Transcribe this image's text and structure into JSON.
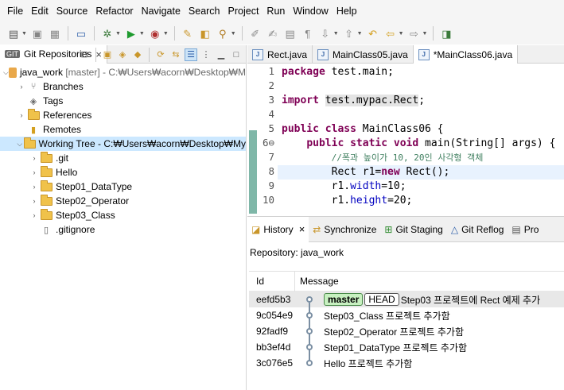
{
  "menu": [
    "File",
    "Edit",
    "Source",
    "Refactor",
    "Navigate",
    "Search",
    "Project",
    "Run",
    "Window",
    "Help"
  ],
  "left_panel": {
    "tab_title": "Git Repositories",
    "close": "×",
    "tree": {
      "repo": {
        "name": "java_work",
        "detail": "[master] - C:₩Users₩acorn₩Desktop₩M"
      },
      "branches": "Branches",
      "tags": "Tags",
      "references": "References",
      "remotes": "Remotes",
      "working_tree": "Working Tree - C:₩Users₩acorn₩Desktop₩My",
      "children": [
        ".git",
        "Hello",
        "Step01_DataType",
        "Step02_Operator",
        "Step03_Class",
        ".gitignore"
      ]
    }
  },
  "editor": {
    "tabs": [
      "Rect.java",
      "MainClass05.java",
      "*MainClass06.java"
    ],
    "lines": [
      {
        "n": "1",
        "text": "package test.main;"
      },
      {
        "n": "2",
        "text": ""
      },
      {
        "n": "3",
        "text": "import test.mypac.Rect;"
      },
      {
        "n": "4",
        "text": ""
      },
      {
        "n": "5",
        "text": "public class MainClass06 {"
      },
      {
        "n": "6⊖",
        "text": "    public static void main(String[] args) {"
      },
      {
        "n": "7",
        "text": "        //폭과 높이가 10, 20인 사각형 객체"
      },
      {
        "n": "8",
        "text": "        Rect r1=new Rect();"
      },
      {
        "n": "9",
        "text": "        r1.width=10;"
      },
      {
        "n": "10",
        "text": "        r1.height=20;"
      }
    ]
  },
  "bottom_panel": {
    "tabs": [
      "History",
      "Synchronize",
      "Git Staging",
      "Git Reflog",
      "Pro"
    ],
    "close": "×",
    "repository_label": "Repository: java_work",
    "columns": [
      "Id",
      "Message"
    ],
    "commits": [
      {
        "id": "eefd5b3",
        "branch": "master",
        "head": "HEAD",
        "message": "Step03 프로젝트에 Rect 예제 추가"
      },
      {
        "id": "9c054e9",
        "message": "Step03_Class 프로젝트 추가함"
      },
      {
        "id": "92fadf9",
        "message": "Step02_Operator 프로젝트 추가함"
      },
      {
        "id": "bb3ef4d",
        "message": "Step01_DataType 프로젝트 추가함"
      },
      {
        "id": "3c076e5",
        "message": "Hello 프로젝트 추가함"
      }
    ]
  }
}
